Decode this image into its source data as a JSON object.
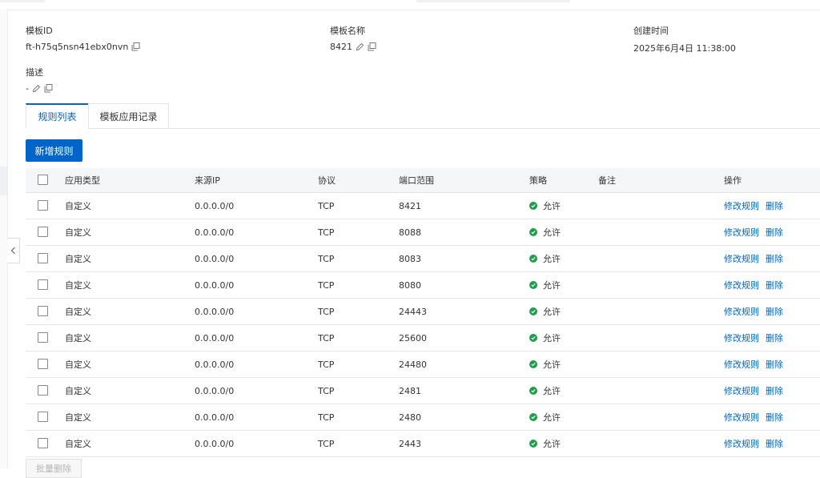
{
  "info": {
    "template_id_label": "模板ID",
    "template_id_value": "ft-h75q5nsn41ebx0nvn",
    "template_name_label": "模板名称",
    "template_name_value": "8421",
    "created_label": "创建时间",
    "created_value": "2025年6月4日 11:38:00",
    "desc_label": "描述",
    "desc_value": "-"
  },
  "tabs": [
    {
      "label": "规则列表",
      "active": true
    },
    {
      "label": "模板应用记录",
      "active": false
    }
  ],
  "add_button_label": "新增规则",
  "batch_button_label": "批量删除",
  "table": {
    "headers": {
      "type": "应用类型",
      "source_ip": "来源IP",
      "protocol": "协议",
      "port_range": "端口范围",
      "policy": "策略",
      "note": "备注",
      "actions": "操作"
    },
    "rows": [
      {
        "type": "自定义",
        "source_ip": "0.0.0.0/0",
        "protocol": "TCP",
        "port_range": "8421",
        "policy": "允许",
        "note": "",
        "edit": "修改规则",
        "delete": "删除"
      },
      {
        "type": "自定义",
        "source_ip": "0.0.0.0/0",
        "protocol": "TCP",
        "port_range": "8088",
        "policy": "允许",
        "note": "",
        "edit": "修改规则",
        "delete": "删除"
      },
      {
        "type": "自定义",
        "source_ip": "0.0.0.0/0",
        "protocol": "TCP",
        "port_range": "8083",
        "policy": "允许",
        "note": "",
        "edit": "修改规则",
        "delete": "删除"
      },
      {
        "type": "自定义",
        "source_ip": "0.0.0.0/0",
        "protocol": "TCP",
        "port_range": "8080",
        "policy": "允许",
        "note": "",
        "edit": "修改规则",
        "delete": "删除"
      },
      {
        "type": "自定义",
        "source_ip": "0.0.0.0/0",
        "protocol": "TCP",
        "port_range": "24443",
        "policy": "允许",
        "note": "",
        "edit": "修改规则",
        "delete": "删除"
      },
      {
        "type": "自定义",
        "source_ip": "0.0.0.0/0",
        "protocol": "TCP",
        "port_range": "25600",
        "policy": "允许",
        "note": "",
        "edit": "修改规则",
        "delete": "删除"
      },
      {
        "type": "自定义",
        "source_ip": "0.0.0.0/0",
        "protocol": "TCP",
        "port_range": "24480",
        "policy": "允许",
        "note": "",
        "edit": "修改规则",
        "delete": "删除"
      },
      {
        "type": "自定义",
        "source_ip": "0.0.0.0/0",
        "protocol": "TCP",
        "port_range": "2481",
        "policy": "允许",
        "note": "",
        "edit": "修改规则",
        "delete": "删除"
      },
      {
        "type": "自定义",
        "source_ip": "0.0.0.0/0",
        "protocol": "TCP",
        "port_range": "2480",
        "policy": "允许",
        "note": "",
        "edit": "修改规则",
        "delete": "删除"
      },
      {
        "type": "自定义",
        "source_ip": "0.0.0.0/0",
        "protocol": "TCP",
        "port_range": "2443",
        "policy": "允许",
        "note": "",
        "edit": "修改规则",
        "delete": "删除"
      }
    ]
  },
  "colors": {
    "accent": "#0064c8",
    "allow": "#1e9d4a"
  },
  "icons": {
    "copy": "copy-icon",
    "edit": "edit-pencil-icon",
    "allow": "check-circle-icon",
    "collapse": "chevron-left-icon"
  }
}
